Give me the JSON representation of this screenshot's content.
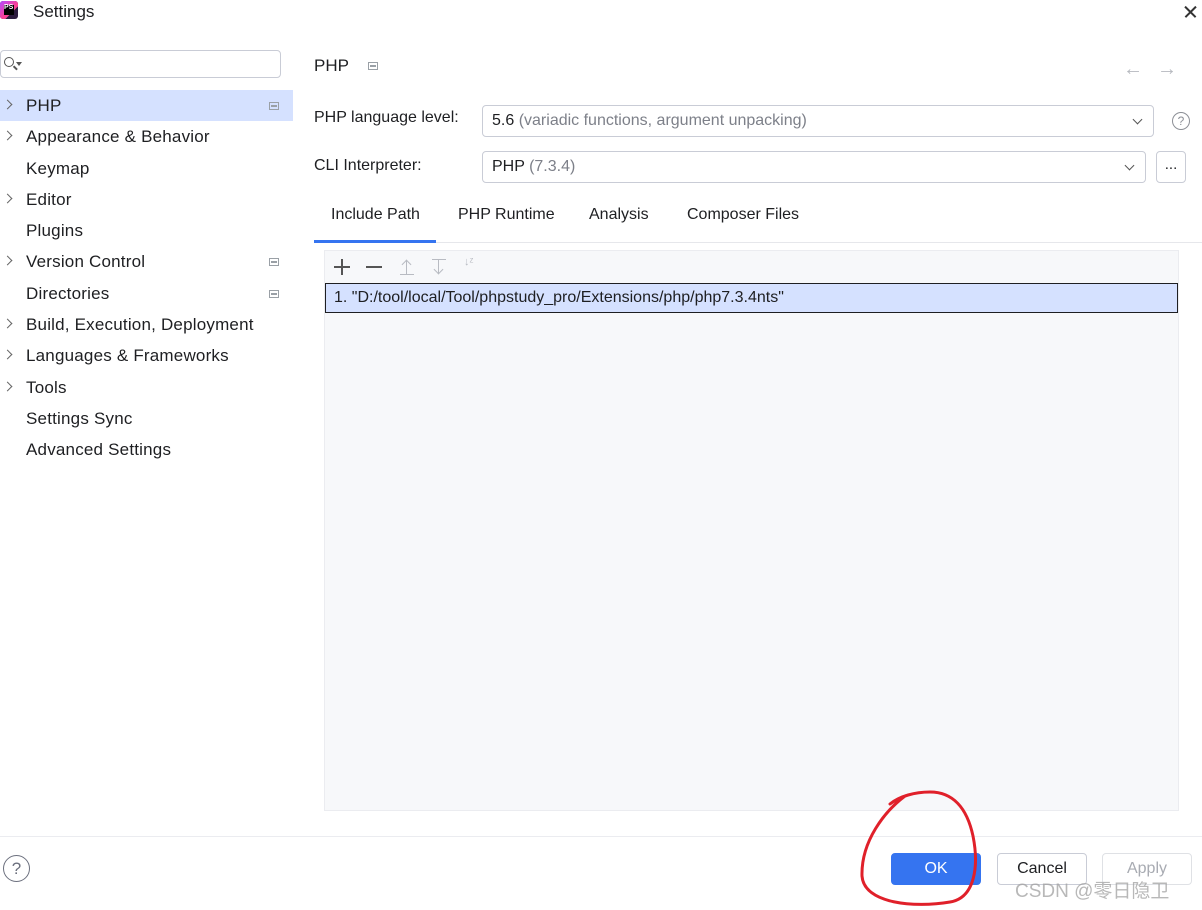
{
  "window": {
    "title": "Settings",
    "app_icon_text": "PS"
  },
  "sidebar": {
    "search_placeholder": "",
    "items": [
      {
        "label": "PHP",
        "expandable": true,
        "selected": true,
        "project_icon": true
      },
      {
        "label": "Appearance & Behavior",
        "expandable": true,
        "selected": false,
        "project_icon": false
      },
      {
        "label": "Keymap",
        "expandable": false,
        "selected": false,
        "project_icon": false
      },
      {
        "label": "Editor",
        "expandable": true,
        "selected": false,
        "project_icon": false
      },
      {
        "label": "Plugins",
        "expandable": false,
        "selected": false,
        "project_icon": false
      },
      {
        "label": "Version Control",
        "expandable": true,
        "selected": false,
        "project_icon": true
      },
      {
        "label": "Directories",
        "expandable": false,
        "selected": false,
        "project_icon": true
      },
      {
        "label": "Build, Execution, Deployment",
        "expandable": true,
        "selected": false,
        "project_icon": false
      },
      {
        "label": "Languages & Frameworks",
        "expandable": true,
        "selected": false,
        "project_icon": false
      },
      {
        "label": "Tools",
        "expandable": true,
        "selected": false,
        "project_icon": false
      },
      {
        "label": "Settings Sync",
        "expandable": false,
        "selected": false,
        "project_icon": false
      },
      {
        "label": "Advanced Settings",
        "expandable": false,
        "selected": false,
        "project_icon": false
      }
    ]
  },
  "main": {
    "title": "PHP",
    "language_level": {
      "label": "PHP language level:",
      "value": "5.6",
      "detail": "(variadic functions, argument unpacking)"
    },
    "cli_interpreter": {
      "label": "CLI Interpreter:",
      "value": "PHP",
      "detail": "(7.3.4)",
      "browse_label": "..."
    },
    "help_glyph": "?",
    "tabs": [
      {
        "label": "Include Path",
        "active": true
      },
      {
        "label": "PHP Runtime",
        "active": false
      },
      {
        "label": "Analysis",
        "active": false
      },
      {
        "label": "Composer Files",
        "active": false
      }
    ],
    "toolbar": {
      "icons": [
        "plus-icon",
        "minus-icon",
        "move-up-icon",
        "move-down-icon",
        "sort-icon"
      ],
      "sort_glyph": "↓ᶻ"
    },
    "include_paths": [
      "1. \"D:/tool/local/Tool/phpstudy_pro/Extensions/php/php7.3.4nts\""
    ]
  },
  "footer": {
    "help_glyph": "?",
    "ok_label": "OK",
    "cancel_label": "Cancel",
    "apply_label": "Apply"
  },
  "watermark": "CSDN @零日隐卫",
  "colors": {
    "accent": "#3574f0",
    "selection": "#d5e1ff",
    "annotation": "#e0202a"
  }
}
